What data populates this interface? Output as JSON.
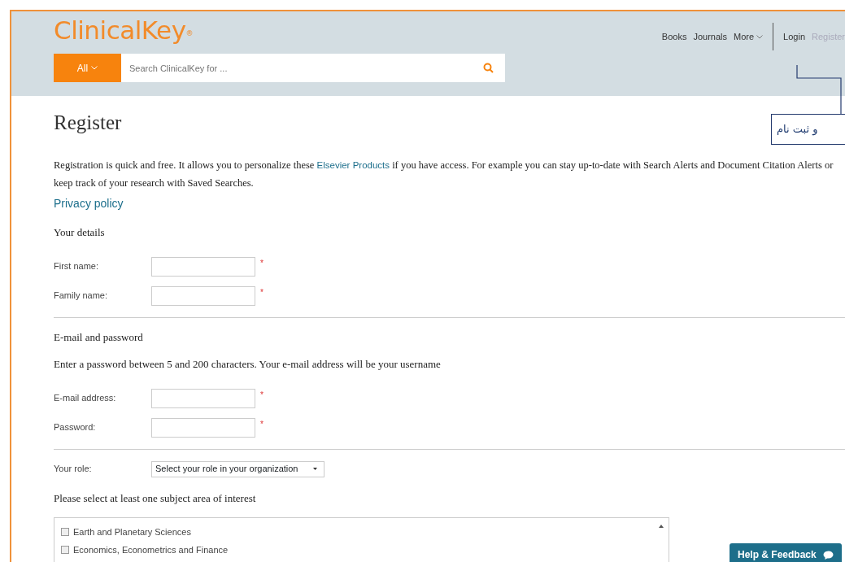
{
  "header": {
    "logo": "ClinicalKey",
    "logo_mark": "®",
    "search": {
      "scope": "All",
      "placeholder": "Search ClinicalKey for ..."
    },
    "nav": [
      {
        "label": "Books",
        "kind": "link",
        "selected": false
      },
      {
        "label": "Journals",
        "kind": "link",
        "selected": false
      },
      {
        "label": "More",
        "kind": "menu",
        "selected": false
      },
      {
        "label": "Login",
        "kind": "link",
        "selected": false
      },
      {
        "label": "Register",
        "kind": "link",
        "selected": true
      }
    ]
  },
  "callout": {
    "text": "و ثبت نام"
  },
  "title": "Register",
  "intro": {
    "before": "Registration is quick and free. It allows you to personalize these ",
    "link": "Elsevier Products",
    "after": " if you have access. For example you can stay up-to-date with Search Alerts and Document Citation Alerts or keep track of your research with Saved Searches."
  },
  "privacy_link": "Privacy policy",
  "sections": [
    {
      "heading": "Your details",
      "fields": [
        {
          "label": "First name:",
          "required_mark": "*"
        },
        {
          "label": "Family name:",
          "required_mark": "*"
        }
      ]
    },
    {
      "heading": "E-mail and password",
      "note": "Enter a password between 5 and 200 characters. Your e-mail address will be your username",
      "fields": [
        {
          "label": "E-mail address:",
          "required_mark": "*"
        },
        {
          "label": "Password:",
          "required_mark": "*"
        }
      ]
    }
  ],
  "role": {
    "label": "Your role:",
    "value": "Select your role in your organization"
  },
  "subjects": {
    "heading": "Please select at least one subject area of interest",
    "items": [
      {
        "label": "Earth and Planetary Sciences",
        "checked": false
      },
      {
        "label": "Economics, Econometrics and Finance",
        "checked": false
      }
    ]
  },
  "help_button": "Help & Feedback"
}
